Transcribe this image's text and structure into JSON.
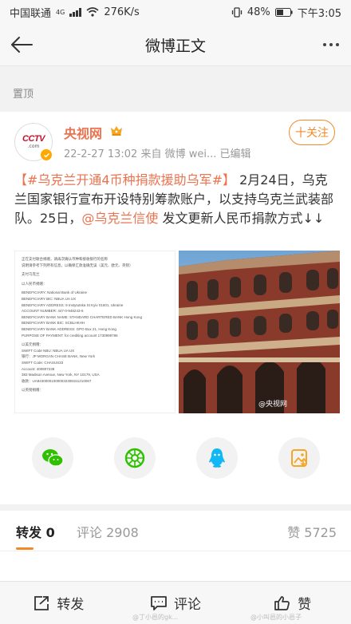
{
  "status_bar": {
    "carrier": "中国联通",
    "network": "4G",
    "speed": "276K/s",
    "battery": "48%",
    "time": "下午3:05"
  },
  "nav": {
    "title": "微博正文"
  },
  "pinned": {
    "label": "置顶"
  },
  "post": {
    "author": "央视网",
    "meta": "22-2-27 13:02  来自 微博 wei...  已编辑",
    "follow_label": "十关注",
    "text_topic": "【#乌克兰开通4币种捐款援助乌军#】",
    "text_part1": " 2月24日，乌克兰国家银行宣布开设特别筹款账户，以支持乌克兰武装部队。25日，",
    "text_mention": "@乌克兰信使",
    "text_part2": " 发文更新人民币捐款方式↓↓",
    "image_watermark": "@央视网"
  },
  "document_image_lines": [
    "正在支付联合捐赠，请再次确认币种和接收银行的名称",
    "说明请参考下列所有信息，以确保汇款准确无误（美元、欧元、英镑）",
    "",
    "支付乌克兰",
    "",
    "以人民币捐赠：",
    "",
    "BENEFICIARY: National Bank of Ukraine",
    "BENEFICIARY BIC: NBUA UA UX",
    "BENEFICIARY ADDRESS: 9 Instytutska St Kyiv 01601, Ukraine",
    "ACCOUNT NUMBER: 447-0-948243-6",
    "BENEFICIARY BANK NAME: STANDARD CHARTERED BANK Hong Kong",
    "BENEFICIARY BANK BIC: SCBLHKHH",
    "BENEFICIARY BANK ADDRESS: GPO Box 21, Hong Kong",
    "PURPOSE OF PAYMENT: for crediting account 1730998786",
    "",
    "以美元捐赠：",
    "SWIFT Code NBU: NBUA UA UX",
    "银行：JP MORGAN CHASE BANK, New York",
    "SWIFT Code: CHASUS33",
    "Account: 400807238",
    "383 Madison Avenue, New York, NY 10179, USA",
    "收款：UA843000010000032308151210067",
    "",
    "以英镑捐赠："
  ],
  "share_icons": [
    "wechat-icon",
    "moments-icon",
    "qq-icon",
    "save-image-icon"
  ],
  "tabs": {
    "forward": "转发 0",
    "comment": "评论 2908",
    "like": "赞 5725"
  },
  "actions": {
    "forward": "转发",
    "comment": "评论",
    "like": "赞"
  },
  "bottom_watermarks": {
    "left": "@丁小邑的gk...",
    "right": "@小叫邑的小邑子"
  },
  "colors": {
    "accent": "#eb7350",
    "follow": "#f08b2a",
    "verified": "#ffa800"
  }
}
